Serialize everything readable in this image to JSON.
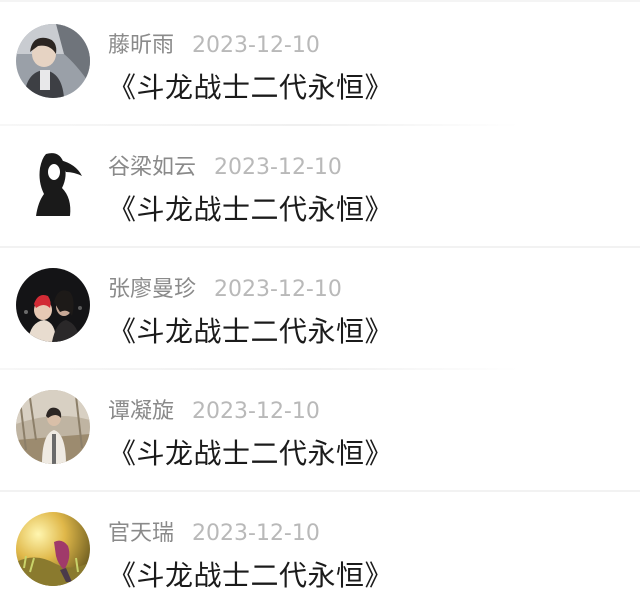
{
  "comments": [
    {
      "name": "藤昕雨",
      "date": "2023-12-10",
      "text": "《斗龙战士二代永恒》"
    },
    {
      "name": "谷梁如云",
      "date": "2023-12-10",
      "text": "《斗龙战士二代永恒》"
    },
    {
      "name": "张廖曼珍",
      "date": "2023-12-10",
      "text": "《斗龙战士二代永恒》"
    },
    {
      "name": "谭凝旋",
      "date": "2023-12-10",
      "text": "《斗龙战士二代永恒》"
    },
    {
      "name": "官天瑞",
      "date": "2023-12-10",
      "text": "《斗龙战士二代永恒》"
    }
  ]
}
